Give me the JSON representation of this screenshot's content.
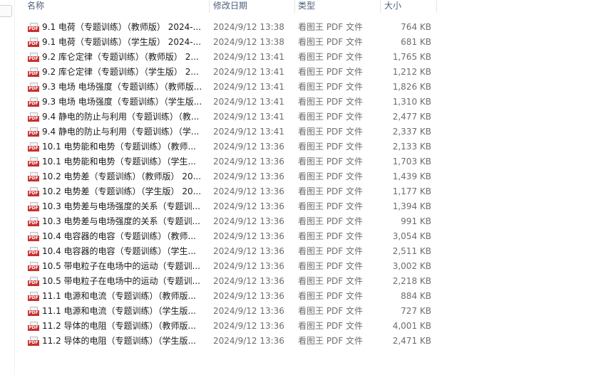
{
  "columns": {
    "name": "名称",
    "date": "修改日期",
    "type": "类型",
    "size": "大小"
  },
  "files": [
    {
      "name": "9.1 电荷（专题训练）（教师版） 2024-...",
      "date": "2024/9/12 13:38",
      "type": "看图王 PDF 文件",
      "size": "764 KB"
    },
    {
      "name": "9.1 电荷（专题训练）（学生版） 2024-...",
      "date": "2024/9/12 13:38",
      "type": "看图王 PDF 文件",
      "size": "681 KB"
    },
    {
      "name": "9.2 库仑定律（专题训练）（教师版） 2...",
      "date": "2024/9/12 13:41",
      "type": "看图王 PDF 文件",
      "size": "1,765 KB"
    },
    {
      "name": "9.2 库仑定律（专题训练）（学生版） 2...",
      "date": "2024/9/12 13:41",
      "type": "看图王 PDF 文件",
      "size": "1,212 KB"
    },
    {
      "name": "9.3 电场 电场强度（专题训练）（教师版...",
      "date": "2024/9/12 13:41",
      "type": "看图王 PDF 文件",
      "size": "1,826 KB"
    },
    {
      "name": "9.3 电场 电场强度（专题训练）（学生版...",
      "date": "2024/9/12 13:41",
      "type": "看图王 PDF 文件",
      "size": "1,310 KB"
    },
    {
      "name": "9.4 静电的防止与利用（专题训练）（教...",
      "date": "2024/9/12 13:41",
      "type": "看图王 PDF 文件",
      "size": "2,477 KB"
    },
    {
      "name": "9.4 静电的防止与利用（专题训练）（学...",
      "date": "2024/9/12 13:41",
      "type": "看图王 PDF 文件",
      "size": "2,337 KB"
    },
    {
      "name": "10.1 电势能和电势（专题训练）（教师...",
      "date": "2024/9/12 13:36",
      "type": "看图王 PDF 文件",
      "size": "2,133 KB"
    },
    {
      "name": "10.1 电势能和电势（专题训练）（学生...",
      "date": "2024/9/12 13:36",
      "type": "看图王 PDF 文件",
      "size": "1,703 KB"
    },
    {
      "name": "10.2 电势差（专题训练）（教师版） 20...",
      "date": "2024/9/12 13:36",
      "type": "看图王 PDF 文件",
      "size": "1,439 KB"
    },
    {
      "name": "10.2 电势差（专题训练）（学生版） 20...",
      "date": "2024/9/12 13:36",
      "type": "看图王 PDF 文件",
      "size": "1,177 KB"
    },
    {
      "name": "10.3 电势差与电场强度的关系（专题训...",
      "date": "2024/9/12 13:36",
      "type": "看图王 PDF 文件",
      "size": "1,394 KB"
    },
    {
      "name": "10.3 电势差与电场强度的关系（专题训...",
      "date": "2024/9/12 13:36",
      "type": "看图王 PDF 文件",
      "size": "991 KB"
    },
    {
      "name": "10.4 电容器的电容（专题训练）（教师...",
      "date": "2024/9/12 13:36",
      "type": "看图王 PDF 文件",
      "size": "3,054 KB"
    },
    {
      "name": "10.4 电容器的电容（专题训练）（学生...",
      "date": "2024/9/12 13:36",
      "type": "看图王 PDF 文件",
      "size": "2,511 KB"
    },
    {
      "name": "10.5 带电粒子在电场中的运动（专题训...",
      "date": "2024/9/12 13:36",
      "type": "看图王 PDF 文件",
      "size": "3,002 KB"
    },
    {
      "name": "10.5 带电粒子在电场中的运动（专题训...",
      "date": "2024/9/12 13:36",
      "type": "看图王 PDF 文件",
      "size": "2,218 KB"
    },
    {
      "name": "11.1 电源和电流（专题训练）（教师版...",
      "date": "2024/9/12 13:36",
      "type": "看图王 PDF 文件",
      "size": "884 KB"
    },
    {
      "name": "11.1 电源和电流（专题训练）（学生版...",
      "date": "2024/9/12 13:36",
      "type": "看图王 PDF 文件",
      "size": "727 KB"
    },
    {
      "name": "11.2 导体的电阻（专题训练）（教师版...",
      "date": "2024/9/12 13:36",
      "type": "看图王 PDF 文件",
      "size": "4,001 KB"
    },
    {
      "name": "11.2 导体的电阻（专题训练）（学生版...",
      "date": "2024/9/12 13:36",
      "type": "看图王 PDF 文件",
      "size": "2,471 KB"
    }
  ],
  "icons": {
    "file_icon": "pdf-file-icon",
    "icon_label": "PDF",
    "icon_color": "#c8302f"
  }
}
